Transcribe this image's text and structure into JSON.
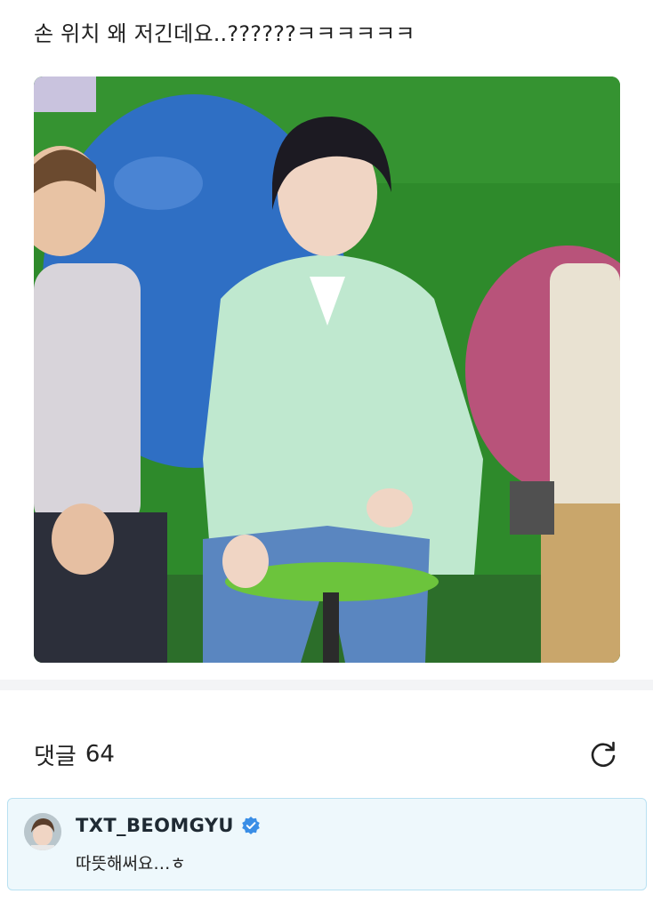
{
  "post": {
    "text": "손 위치 왜 저긴데요..??????ㅋㅋㅋㅋㅋㅋ"
  },
  "comments": {
    "label": "댓글",
    "count": "64",
    "refresh_icon": "refresh-icon",
    "items": [
      {
        "author": "TXT_BEOMGYU",
        "verified": true,
        "text": "따뜻해써요…ㅎ"
      }
    ]
  },
  "colors": {
    "comment_bg": "#eef8fc",
    "comment_border": "#b9e1f2",
    "verified": "#3a8ee6"
  }
}
